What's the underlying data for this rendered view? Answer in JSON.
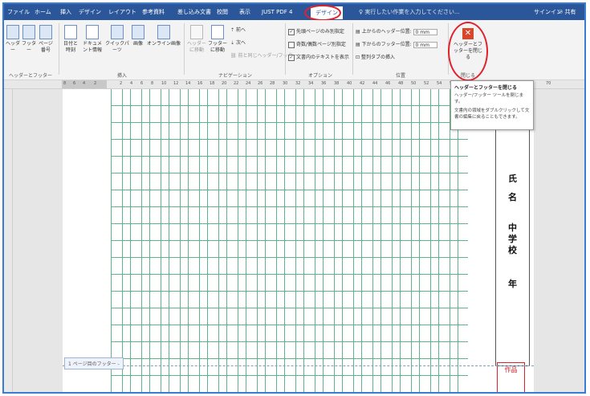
{
  "tabs": [
    "ファイル",
    "ホーム",
    "挿入",
    "デザイン",
    "レイアウト",
    "参考資料",
    "差し込み文書",
    "校閲",
    "表示",
    "JUST PDF 4",
    "デザイン"
  ],
  "active_tab_index": 10,
  "search": {
    "text": "実行したい作業を入力してください..."
  },
  "account": {
    "signin": "サインイン",
    "share": "共有"
  },
  "ribbon": {
    "header_footer_group": {
      "label": "ヘッダーとフッター",
      "buttons": [
        "ヘッダー",
        "フッター",
        "ページ番号"
      ]
    },
    "insert_group": {
      "label": "挿入",
      "buttons": [
        "日付と時刻",
        "ドキュメント情報",
        "クイックパーツ",
        "画像",
        "オンライン画像"
      ]
    },
    "navigation_group": {
      "label": "ナビゲーション",
      "buttons": [
        "ヘッダーに移動",
        "フッターに移動"
      ],
      "prev": "前へ",
      "next": "次へ",
      "link_prev": "前と同じヘッダー/フッター"
    },
    "options_group": {
      "label": "オプション",
      "items": [
        {
          "label": "先頭ページのみ別指定",
          "checked": true
        },
        {
          "label": "奇数/偶数ページ別指定",
          "checked": false
        },
        {
          "label": "文書内のテキストを表示",
          "checked": true
        }
      ]
    },
    "position_group": {
      "label": "位置",
      "header_pos_label": "上からのヘッダー位置:",
      "header_pos_value": "0 mm",
      "footer_pos_label": "下からのフッター位置:",
      "footer_pos_value": "0 mm",
      "align_tab": "整列タブの挿入"
    },
    "close_group": {
      "label": "閉じる",
      "button": "ヘッダーとフッターを閉じる"
    }
  },
  "ruler": {
    "numbers": [
      "8",
      "6",
      "4",
      "2",
      "2",
      "4",
      "6",
      "8",
      "10",
      "12",
      "14",
      "16",
      "18",
      "20",
      "22",
      "24",
      "26",
      "28",
      "30",
      "32",
      "34",
      "36",
      "38",
      "40",
      "42",
      "44",
      "46",
      "48",
      "50",
      "52",
      "54",
      "56"
    ],
    "right_num": "70"
  },
  "tooltip": {
    "title": "ヘッダーとフッターを閉じる",
    "line1": "ヘッダー/フッター ツールを閉じます。",
    "line2": "文書内の領域をダブルクリックして文書の編集に戻ることもできます。"
  },
  "document": {
    "name_label_1": "氏",
    "name_label_2": "名",
    "school": [
      "中",
      "学",
      "校"
    ],
    "grade": "年",
    "footer_tag": "1 ページ目のフッター -",
    "stamp": "作品"
  },
  "colors": {
    "accent": "#2b579a",
    "grid": "#5fb38d",
    "highlight": "#e0212b",
    "close": "#d9472b"
  }
}
